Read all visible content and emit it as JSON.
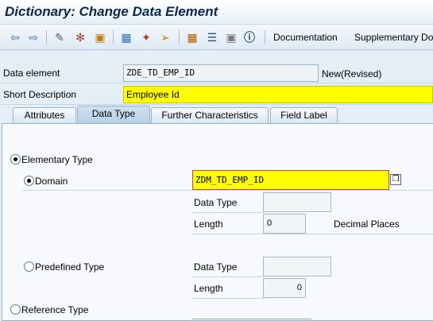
{
  "window": {
    "title": "Dictionary: Change Data Element"
  },
  "toolbar": {
    "icons": [
      "back-arrow-icon",
      "forward-arrow-icon",
      "display-change-icon",
      "activate-icon",
      "check-icon",
      "hierarchy-icon",
      "magic-wand-icon",
      "where-used-icon",
      "org-chart-icon",
      "list-icon",
      "grid-icon",
      "info-icon"
    ],
    "documentation_label": "Documentation",
    "supplementary_label": "Supplementary Do"
  },
  "header": {
    "data_element_label": "Data element",
    "data_element_value": "ZDE_TD_EMP_ID",
    "status": "New(Revised)",
    "short_description_label": "Short Description",
    "short_description_value": "Employee Id"
  },
  "tabs": [
    {
      "label": "Attributes",
      "active": false
    },
    {
      "label": "Data Type",
      "active": true
    },
    {
      "label": "Further Characteristics",
      "active": false
    },
    {
      "label": "Field Label",
      "active": false
    }
  ],
  "data_type": {
    "elementary_type_label": "Elementary Type",
    "domain_label": "Domain",
    "domain_value": "ZDM_TD_EMP_ID",
    "domain_data_type_label": "Data Type",
    "domain_data_type_value": "",
    "domain_length_label": "Length",
    "domain_length_value": "0",
    "decimal_places_label": "Decimal Places",
    "predefined_type_label": "Predefined Type",
    "predefined_data_type_label": "Data Type",
    "predefined_data_type_value": "",
    "predefined_length_label": "Length",
    "predefined_length_value": "0",
    "reference_type_label": "Reference Type"
  }
}
